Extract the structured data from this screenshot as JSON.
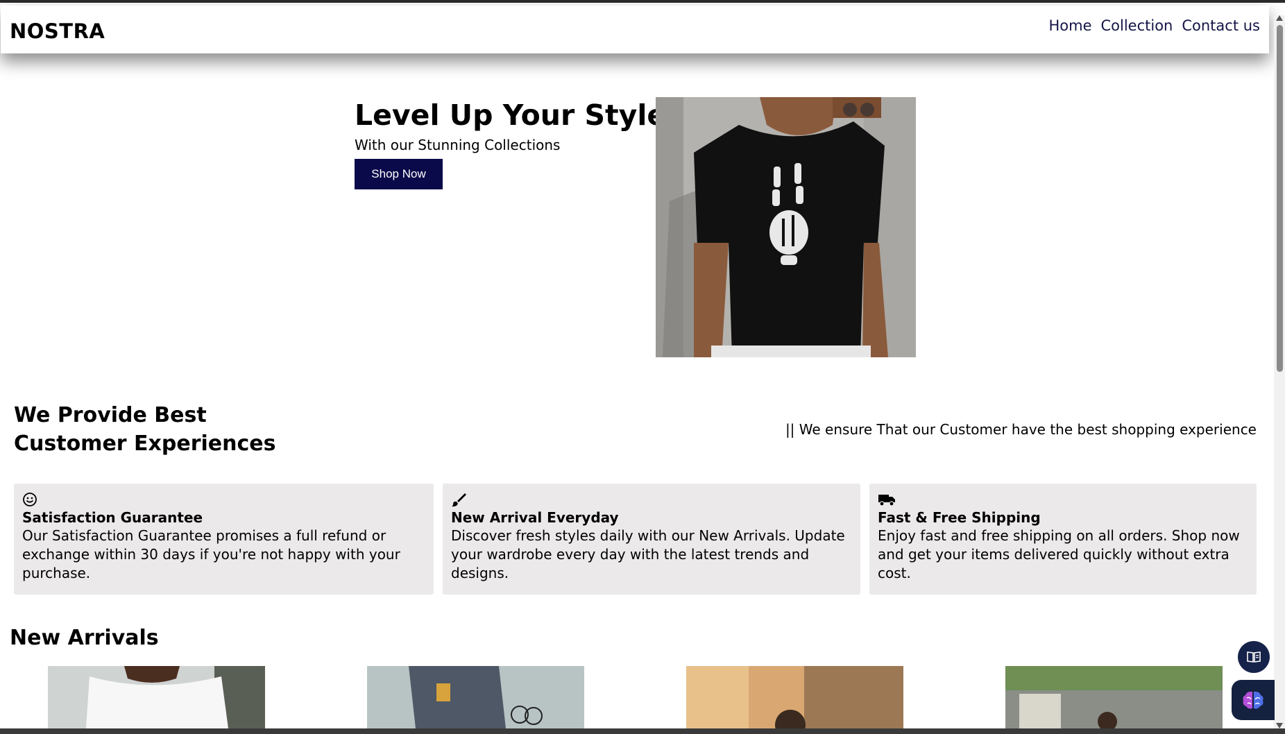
{
  "header": {
    "brand": "NOSTRA",
    "nav": [
      "Home",
      "Collection",
      "Contact us"
    ]
  },
  "hero": {
    "title": "Level Up Your Style",
    "subtitle": "With our Stunning Collections",
    "cta_label": "Shop Now"
  },
  "experience": {
    "title_line1": "We Provide Best",
    "title_line2": "Customer Experiences",
    "tagline": "|| We ensure That our Customer have the best shopping experience"
  },
  "features": [
    {
      "icon": "smile-icon",
      "title": "Satisfaction Guarantee",
      "text": "Our Satisfaction Guarantee promises a full refund or exchange within 30 days if you're not happy with your purchase."
    },
    {
      "icon": "paintbrush-icon",
      "title": "New Arrival Everyday",
      "text": "Discover fresh styles daily with our New Arrivals. Update your wardrobe every day with the latest trends and designs."
    },
    {
      "icon": "truck-icon",
      "title": "Fast & Free Shipping",
      "text": "Enjoy fast and free shipping on all orders. Shop now and get your items delivered quickly without extra cost."
    }
  ],
  "arrivals": {
    "title": "New Arrivals"
  },
  "colors": {
    "brand_dark": "#0a0a4a",
    "nav_link": "#141447",
    "card_bg": "#ebe9e9"
  }
}
